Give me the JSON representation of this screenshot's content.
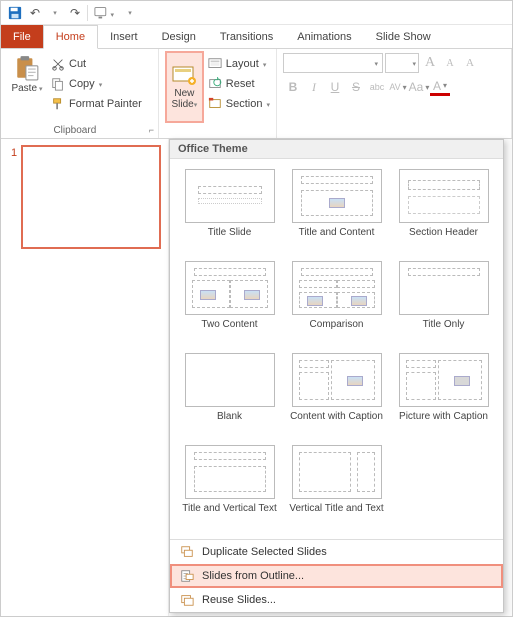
{
  "qat": {
    "save": "save",
    "undo": "undo",
    "redo": "redo",
    "start": "start-from-beginning",
    "customize": "customize"
  },
  "tabs": {
    "file": "File",
    "home": "Home",
    "insert": "Insert",
    "design": "Design",
    "transitions": "Transitions",
    "animations": "Animations",
    "slideshow": "Slide Show"
  },
  "clipboard": {
    "paste": "Paste",
    "cut": "Cut",
    "copy": "Copy",
    "format_painter": "Format Painter",
    "group_label": "Clipboard"
  },
  "slides": {
    "new_slide": "New Slide",
    "layout": "Layout",
    "reset": "Reset",
    "section": "Section"
  },
  "font": {
    "name_placeholder": "",
    "size_placeholder": "",
    "grow": "A",
    "shrink": "A",
    "clear": "A",
    "bold": "B",
    "italic": "I",
    "underline": "U",
    "strike": "S",
    "abc": "abc",
    "av": "AV",
    "aa": "Aa",
    "color": "A"
  },
  "panel": {
    "slide_number": "1"
  },
  "gallery": {
    "heading": "Office Theme",
    "layouts": [
      "Title Slide",
      "Title and Content",
      "Section Header",
      "Two Content",
      "Comparison",
      "Title Only",
      "Blank",
      "Content with Caption",
      "Picture with Caption",
      "Title and Vertical Text",
      "Vertical Title and Text"
    ],
    "menu": {
      "duplicate": "Duplicate Selected Slides",
      "from_outline": "Slides from Outline...",
      "reuse": "Reuse Slides..."
    }
  }
}
